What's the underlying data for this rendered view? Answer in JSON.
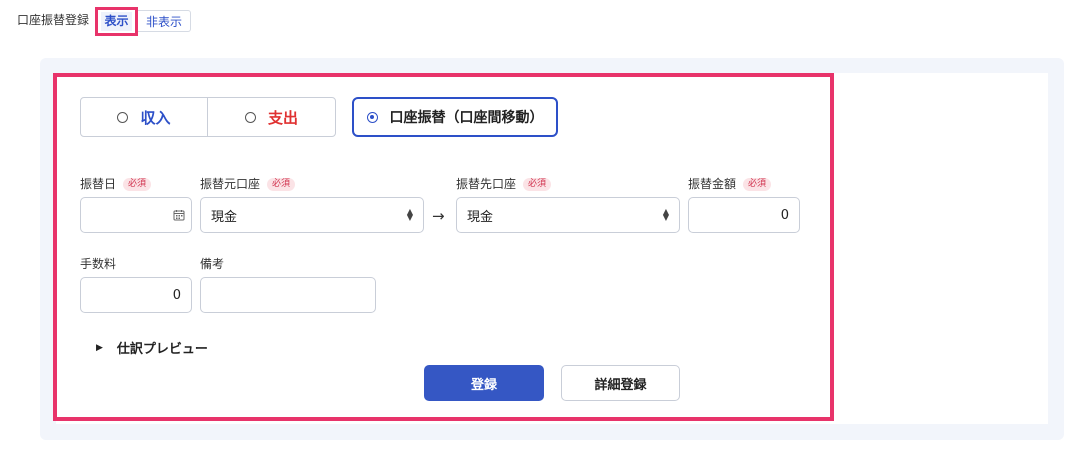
{
  "header": {
    "section_label": "口座振替登録",
    "show_label": "表示",
    "hide_label": "非表示"
  },
  "type_tabs": {
    "income": "収入",
    "expense": "支出",
    "transfer": "口座振替（口座間移動）",
    "selected": "transfer"
  },
  "form": {
    "required_badge": "必須",
    "transfer_date": {
      "label": "振替日",
      "value": ""
    },
    "from_account": {
      "label": "振替元口座",
      "value": "現金"
    },
    "to_account": {
      "label": "振替先口座",
      "value": "現金"
    },
    "amount": {
      "label": "振替金額",
      "value": "0"
    },
    "fee": {
      "label": "手数料",
      "value": "0"
    },
    "memo": {
      "label": "備考",
      "value": ""
    }
  },
  "preview": {
    "label": "仕訳プレビュー"
  },
  "actions": {
    "register": "登録",
    "detail_register": "詳細登録"
  },
  "colors": {
    "accent": "#2d50c8",
    "highlight": "#e8336a",
    "primary_button": "#3557c4",
    "expense": "#e03131"
  },
  "icons": {
    "calendar": "calendar-icon",
    "arrow": "arrow-right-icon",
    "select": "select-updown-icon",
    "expand": "caret-right-icon"
  }
}
